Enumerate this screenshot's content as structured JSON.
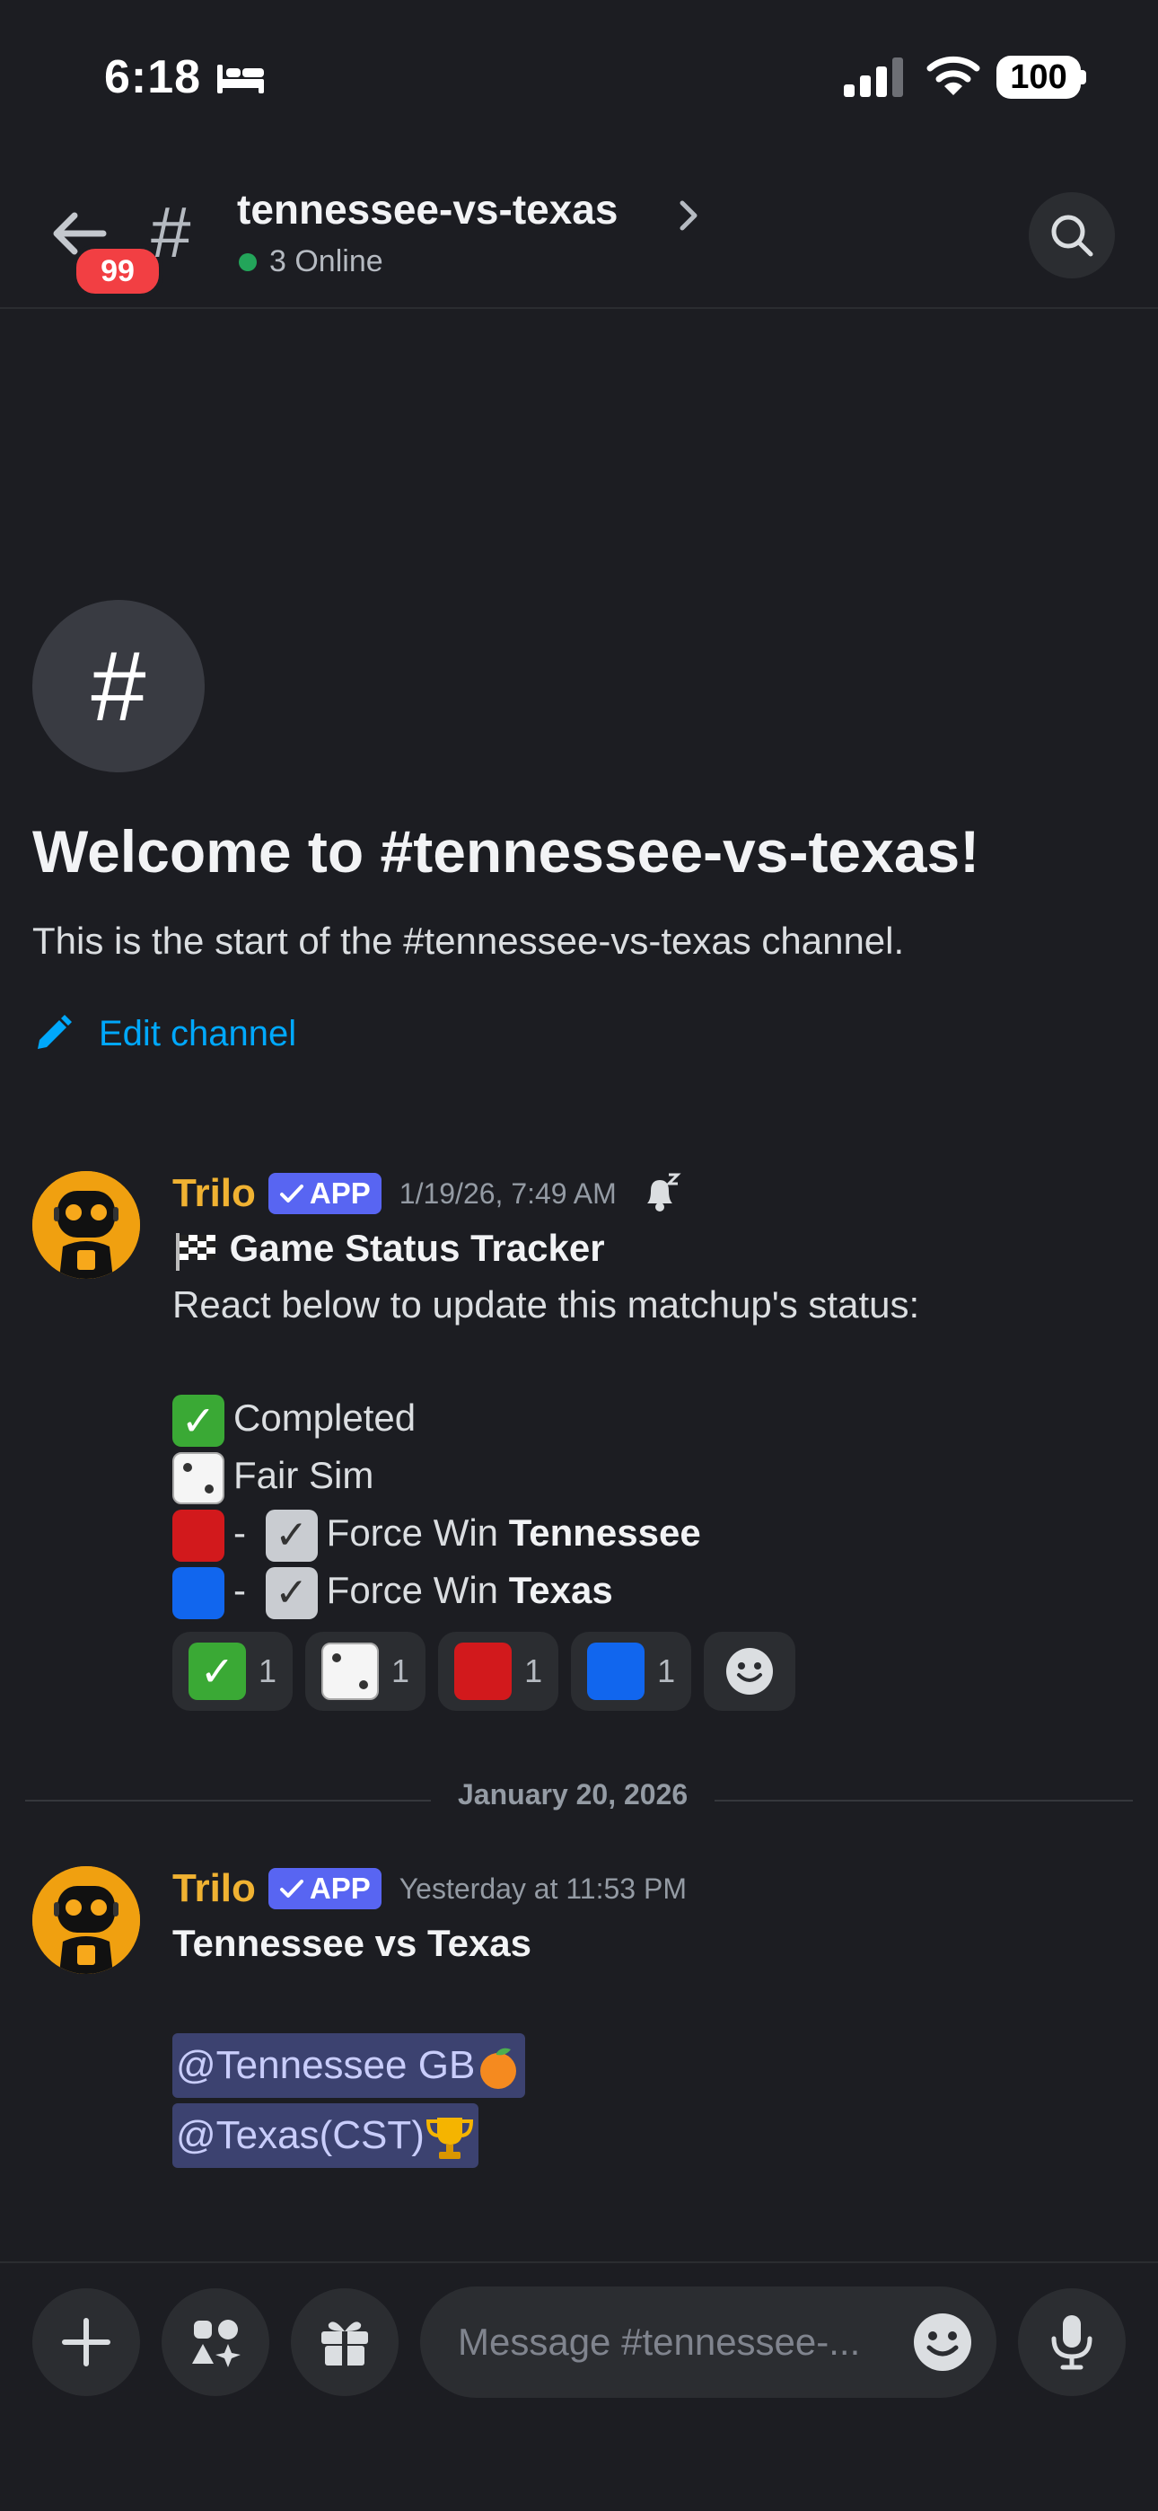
{
  "status_bar": {
    "time": "6:18",
    "battery": "100"
  },
  "header": {
    "unread_badge": "99",
    "channel_hash": "#",
    "channel_name": "tennessee-vs-texas",
    "online_text": "3 Online"
  },
  "welcome": {
    "icon": "#",
    "title": "Welcome to #tennessee-vs-texas!",
    "subtitle": "This is the start of the #tennessee-vs-texas channel.",
    "edit_label": "Edit channel"
  },
  "message1": {
    "author": "Trilo",
    "app_label": "APP",
    "timestamp": "1/19/26, 7:49 AM",
    "title": "Game Status Tracker",
    "intro": "React below to update this matchup's status:",
    "options": [
      {
        "text": "Completed"
      },
      {
        "text": "Fair Sim"
      },
      {
        "text": "Force Win ",
        "team": "Tennessee"
      },
      {
        "text": "Force Win ",
        "team": "Texas"
      }
    ],
    "dash": "-",
    "reactions": [
      {
        "emoji": "check-mark-button",
        "count": "1"
      },
      {
        "emoji": "game-die",
        "count": "1"
      },
      {
        "emoji": "red-square",
        "count": "1"
      },
      {
        "emoji": "blue-square",
        "count": "1"
      }
    ]
  },
  "date_separator": "January 20, 2026",
  "message2": {
    "author": "Trilo",
    "app_label": "APP",
    "timestamp": "Yesterday at 11:53 PM",
    "title": "Tennessee vs Texas",
    "mentions": [
      "@Tennessee GB",
      "@Texas(CST)"
    ]
  },
  "composer": {
    "placeholder": "Message #tennessee-..."
  },
  "colors": {
    "background": "#1c1d22",
    "accent_blurple": "#5865f2",
    "author_gold": "#f0b232",
    "link_blue": "#00a8fc",
    "badge_red": "#f23f43",
    "online_green": "#23a55a"
  }
}
